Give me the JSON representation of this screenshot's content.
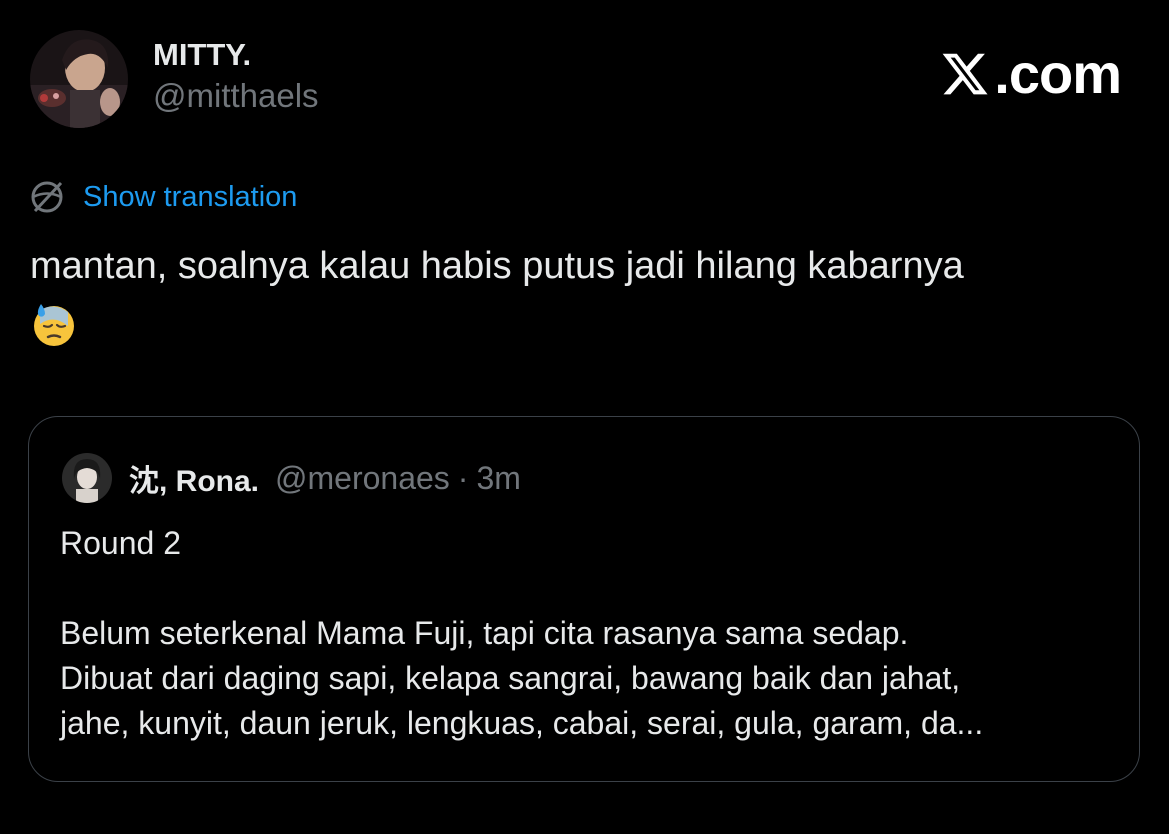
{
  "author": {
    "display_name": "MITTY.",
    "handle": "@mitthaels"
  },
  "brand": {
    "logo_icon": "x-logo-icon",
    "text": ".com"
  },
  "translate": {
    "icon": "globe-icon",
    "label": "Show translation"
  },
  "tweet": {
    "text": "mantan, soalnya kalau habis putus jadi hilang kabarnya",
    "emoji": "downcast-face-with-sweat-emoji"
  },
  "quote": {
    "display_name": "沈, Rona.",
    "handle": "@meronaes",
    "separator": "·",
    "time": "3m",
    "first_line": "Round 2",
    "body_lines": [
      "Belum seterkenal Mama Fuji, tapi cita rasanya sama sedap.",
      "Dibuat dari daging sapi, kelapa sangrai, bawang baik dan jahat,",
      "jahe, kunyit, daun jeruk, lengkuas, cabai, serai, gula, garam, da..."
    ]
  },
  "colors": {
    "background": "#000000",
    "text_primary": "#e7e9ea",
    "text_secondary": "#71767b",
    "link": "#1d9bf0",
    "border": "#3b4148"
  }
}
